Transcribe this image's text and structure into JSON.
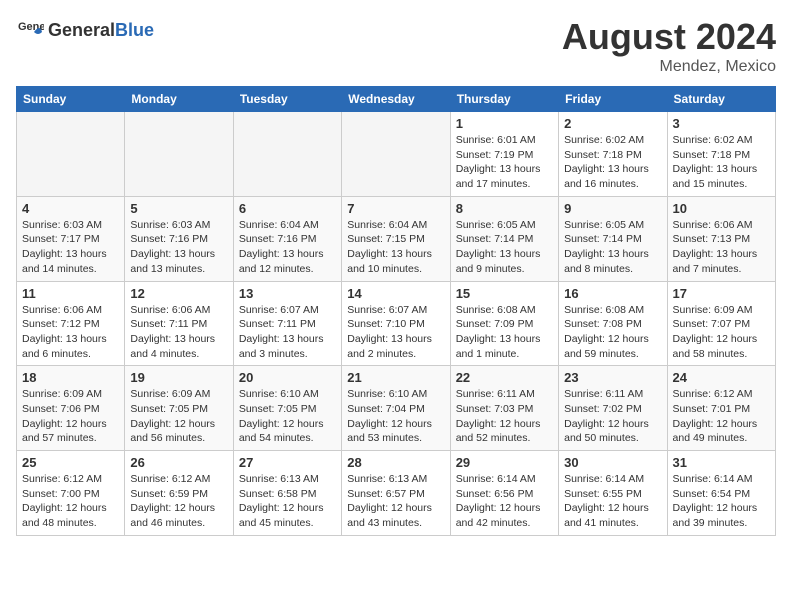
{
  "header": {
    "logo_general": "General",
    "logo_blue": "Blue",
    "title": "August 2024",
    "location": "Mendez, Mexico"
  },
  "calendar": {
    "days_of_week": [
      "Sunday",
      "Monday",
      "Tuesday",
      "Wednesday",
      "Thursday",
      "Friday",
      "Saturday"
    ],
    "weeks": [
      [
        {
          "day": "",
          "empty": true
        },
        {
          "day": "",
          "empty": true
        },
        {
          "day": "",
          "empty": true
        },
        {
          "day": "",
          "empty": true
        },
        {
          "day": "1",
          "sunrise": "Sunrise: 6:01 AM",
          "sunset": "Sunset: 7:19 PM",
          "daylight": "Daylight: 13 hours and 17 minutes."
        },
        {
          "day": "2",
          "sunrise": "Sunrise: 6:02 AM",
          "sunset": "Sunset: 7:18 PM",
          "daylight": "Daylight: 13 hours and 16 minutes."
        },
        {
          "day": "3",
          "sunrise": "Sunrise: 6:02 AM",
          "sunset": "Sunset: 7:18 PM",
          "daylight": "Daylight: 13 hours and 15 minutes."
        }
      ],
      [
        {
          "day": "4",
          "sunrise": "Sunrise: 6:03 AM",
          "sunset": "Sunset: 7:17 PM",
          "daylight": "Daylight: 13 hours and 14 minutes."
        },
        {
          "day": "5",
          "sunrise": "Sunrise: 6:03 AM",
          "sunset": "Sunset: 7:16 PM",
          "daylight": "Daylight: 13 hours and 13 minutes."
        },
        {
          "day": "6",
          "sunrise": "Sunrise: 6:04 AM",
          "sunset": "Sunset: 7:16 PM",
          "daylight": "Daylight: 13 hours and 12 minutes."
        },
        {
          "day": "7",
          "sunrise": "Sunrise: 6:04 AM",
          "sunset": "Sunset: 7:15 PM",
          "daylight": "Daylight: 13 hours and 10 minutes."
        },
        {
          "day": "8",
          "sunrise": "Sunrise: 6:05 AM",
          "sunset": "Sunset: 7:14 PM",
          "daylight": "Daylight: 13 hours and 9 minutes."
        },
        {
          "day": "9",
          "sunrise": "Sunrise: 6:05 AM",
          "sunset": "Sunset: 7:14 PM",
          "daylight": "Daylight: 13 hours and 8 minutes."
        },
        {
          "day": "10",
          "sunrise": "Sunrise: 6:06 AM",
          "sunset": "Sunset: 7:13 PM",
          "daylight": "Daylight: 13 hours and 7 minutes."
        }
      ],
      [
        {
          "day": "11",
          "sunrise": "Sunrise: 6:06 AM",
          "sunset": "Sunset: 7:12 PM",
          "daylight": "Daylight: 13 hours and 6 minutes."
        },
        {
          "day": "12",
          "sunrise": "Sunrise: 6:06 AM",
          "sunset": "Sunset: 7:11 PM",
          "daylight": "Daylight: 13 hours and 4 minutes."
        },
        {
          "day": "13",
          "sunrise": "Sunrise: 6:07 AM",
          "sunset": "Sunset: 7:11 PM",
          "daylight": "Daylight: 13 hours and 3 minutes."
        },
        {
          "day": "14",
          "sunrise": "Sunrise: 6:07 AM",
          "sunset": "Sunset: 7:10 PM",
          "daylight": "Daylight: 13 hours and 2 minutes."
        },
        {
          "day": "15",
          "sunrise": "Sunrise: 6:08 AM",
          "sunset": "Sunset: 7:09 PM",
          "daylight": "Daylight: 13 hours and 1 minute."
        },
        {
          "day": "16",
          "sunrise": "Sunrise: 6:08 AM",
          "sunset": "Sunset: 7:08 PM",
          "daylight": "Daylight: 12 hours and 59 minutes."
        },
        {
          "day": "17",
          "sunrise": "Sunrise: 6:09 AM",
          "sunset": "Sunset: 7:07 PM",
          "daylight": "Daylight: 12 hours and 58 minutes."
        }
      ],
      [
        {
          "day": "18",
          "sunrise": "Sunrise: 6:09 AM",
          "sunset": "Sunset: 7:06 PM",
          "daylight": "Daylight: 12 hours and 57 minutes."
        },
        {
          "day": "19",
          "sunrise": "Sunrise: 6:09 AM",
          "sunset": "Sunset: 7:05 PM",
          "daylight": "Daylight: 12 hours and 56 minutes."
        },
        {
          "day": "20",
          "sunrise": "Sunrise: 6:10 AM",
          "sunset": "Sunset: 7:05 PM",
          "daylight": "Daylight: 12 hours and 54 minutes."
        },
        {
          "day": "21",
          "sunrise": "Sunrise: 6:10 AM",
          "sunset": "Sunset: 7:04 PM",
          "daylight": "Daylight: 12 hours and 53 minutes."
        },
        {
          "day": "22",
          "sunrise": "Sunrise: 6:11 AM",
          "sunset": "Sunset: 7:03 PM",
          "daylight": "Daylight: 12 hours and 52 minutes."
        },
        {
          "day": "23",
          "sunrise": "Sunrise: 6:11 AM",
          "sunset": "Sunset: 7:02 PM",
          "daylight": "Daylight: 12 hours and 50 minutes."
        },
        {
          "day": "24",
          "sunrise": "Sunrise: 6:12 AM",
          "sunset": "Sunset: 7:01 PM",
          "daylight": "Daylight: 12 hours and 49 minutes."
        }
      ],
      [
        {
          "day": "25",
          "sunrise": "Sunrise: 6:12 AM",
          "sunset": "Sunset: 7:00 PM",
          "daylight": "Daylight: 12 hours and 48 minutes."
        },
        {
          "day": "26",
          "sunrise": "Sunrise: 6:12 AM",
          "sunset": "Sunset: 6:59 PM",
          "daylight": "Daylight: 12 hours and 46 minutes."
        },
        {
          "day": "27",
          "sunrise": "Sunrise: 6:13 AM",
          "sunset": "Sunset: 6:58 PM",
          "daylight": "Daylight: 12 hours and 45 minutes."
        },
        {
          "day": "28",
          "sunrise": "Sunrise: 6:13 AM",
          "sunset": "Sunset: 6:57 PM",
          "daylight": "Daylight: 12 hours and 43 minutes."
        },
        {
          "day": "29",
          "sunrise": "Sunrise: 6:14 AM",
          "sunset": "Sunset: 6:56 PM",
          "daylight": "Daylight: 12 hours and 42 minutes."
        },
        {
          "day": "30",
          "sunrise": "Sunrise: 6:14 AM",
          "sunset": "Sunset: 6:55 PM",
          "daylight": "Daylight: 12 hours and 41 minutes."
        },
        {
          "day": "31",
          "sunrise": "Sunrise: 6:14 AM",
          "sunset": "Sunset: 6:54 PM",
          "daylight": "Daylight: 12 hours and 39 minutes."
        }
      ]
    ]
  }
}
